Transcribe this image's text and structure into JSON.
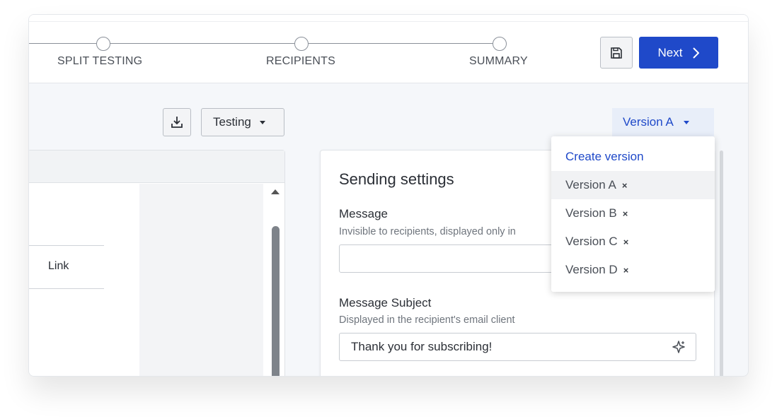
{
  "steps": [
    {
      "label": "SPLIT TESTING"
    },
    {
      "label": "RECIPIENTS"
    },
    {
      "label": "SUMMARY"
    }
  ],
  "header": {
    "save_icon": "floppy-disk-icon",
    "next_label": "Next",
    "next_icon": "chevron-right-icon"
  },
  "toolbar": {
    "download_icon": "download-icon",
    "testing_label": "Testing",
    "version_label": "Version A"
  },
  "editor": {
    "link_label": "Link"
  },
  "settings": {
    "title": "Sending settings",
    "message_label": "Message",
    "message_help": "Invisible to recipients, displayed only in",
    "message_value": "",
    "subject_label": "Message Subject",
    "subject_help": "Displayed in the recipient's email client",
    "subject_value": "Thank you for subscribing!"
  },
  "version_menu": {
    "create_label": "Create version",
    "items": [
      {
        "label": "Version A",
        "remove": "×",
        "active": true
      },
      {
        "label": "Version B",
        "remove": "×"
      },
      {
        "label": "Version C",
        "remove": "×"
      },
      {
        "label": "Version D",
        "remove": "×"
      }
    ]
  },
  "colors": {
    "primary": "#1f49c9",
    "version_bg": "#e8eef9"
  }
}
